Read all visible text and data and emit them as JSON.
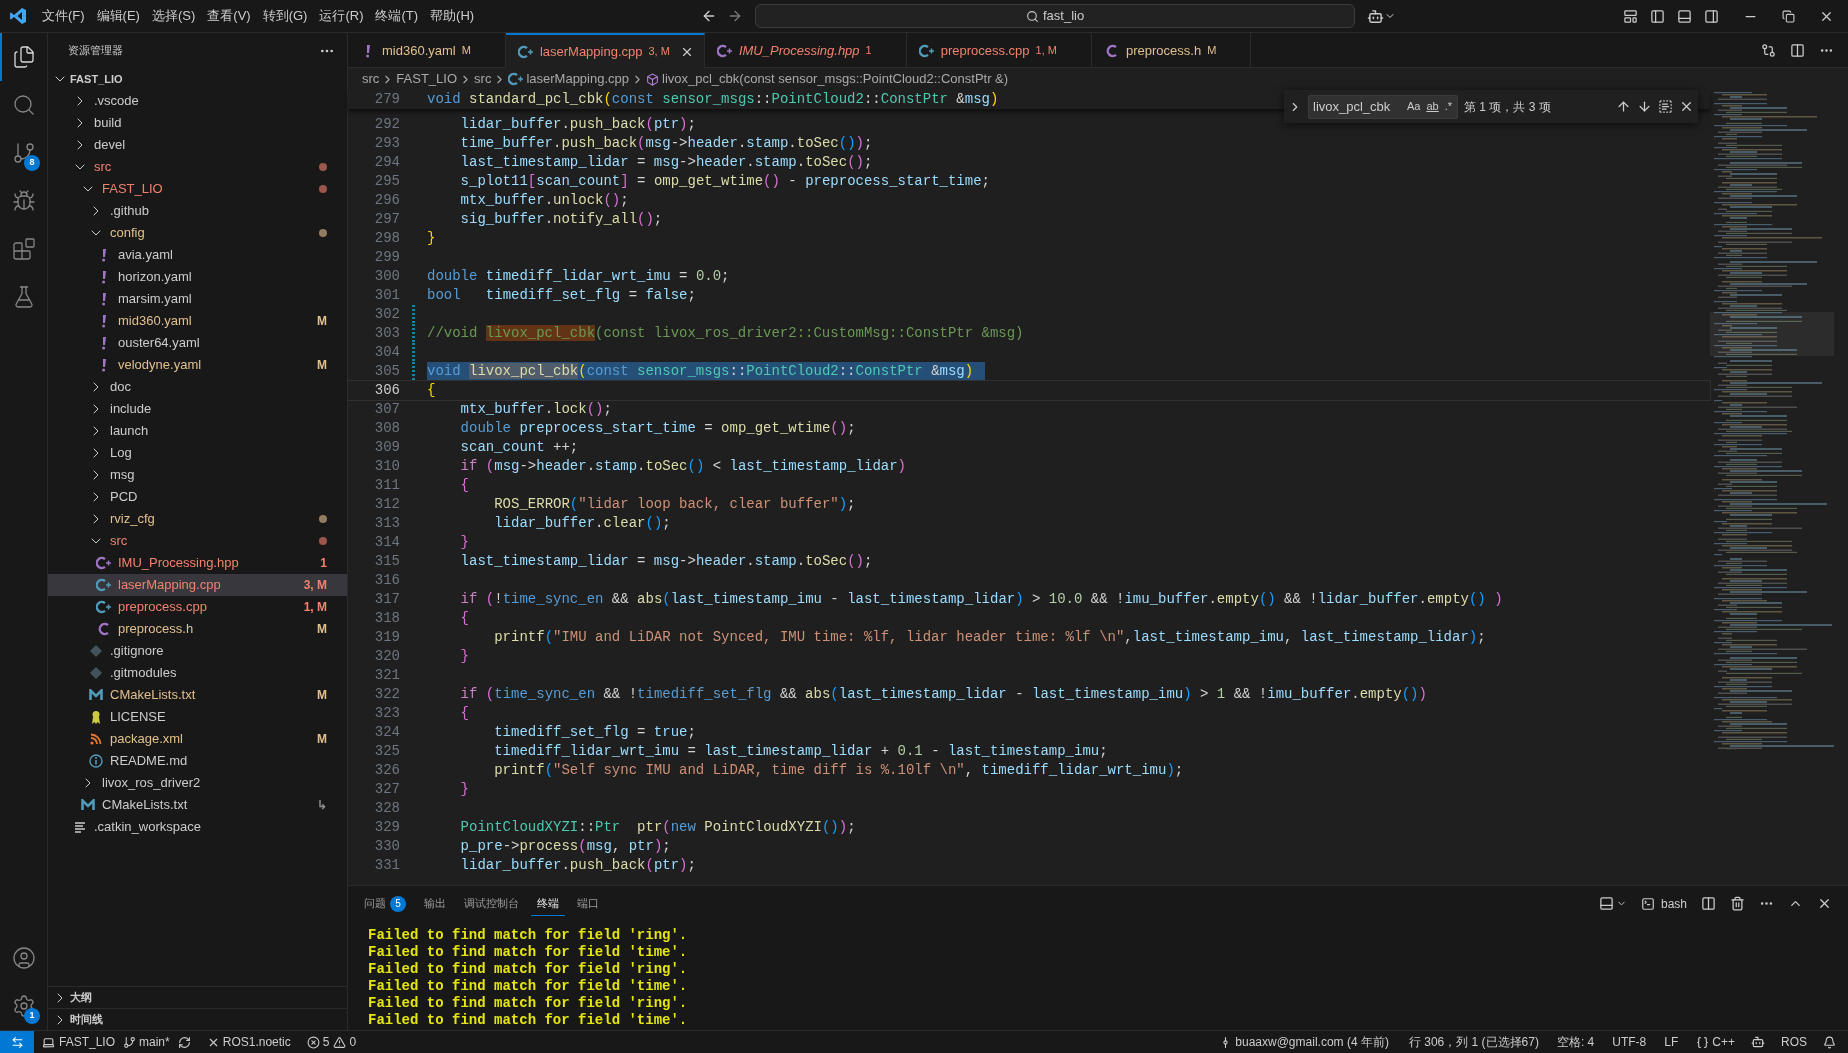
{
  "title_bar": {
    "menus": [
      "文件(F)",
      "编辑(E)",
      "选择(S)",
      "查看(V)",
      "转到(G)",
      "运行(R)",
      "终端(T)",
      "帮助(H)"
    ],
    "search": "fast_lio"
  },
  "activity_bar": {
    "items": [
      {
        "kind": "explorer",
        "selected": true
      },
      {
        "kind": "search",
        "selected": false
      },
      {
        "kind": "scm",
        "selected": false,
        "badge": "8"
      },
      {
        "kind": "debug",
        "selected": false
      },
      {
        "kind": "extensions",
        "selected": false
      },
      {
        "kind": "testing",
        "selected": false
      }
    ],
    "bottom": [
      {
        "kind": "account"
      },
      {
        "kind": "settings",
        "badge": "1"
      }
    ]
  },
  "explorer": {
    "title": "资源管理器",
    "root": {
      "label": "FAST_LIO",
      "expanded": true,
      "children": [
        {
          "label": ".vscode",
          "kind": "folder",
          "expanded": false,
          "selected": false
        },
        {
          "label": "build",
          "kind": "folder",
          "expanded": false,
          "selected": false
        },
        {
          "label": "devel",
          "kind": "folder",
          "expanded": false,
          "selected": false
        },
        {
          "label": "src",
          "kind": "folder",
          "expanded": true,
          "selected": false,
          "color": "#f2826f",
          "children": [
            {
              "label": "FAST_LIO",
              "kind": "folder",
              "expanded": true,
              "selected": false,
              "color": "#f2826f",
              "children": [
                {
                  "label": ".github",
                  "kind": "folder",
                  "expanded": false,
                  "selected": false
                },
                {
                  "label": "config",
                  "kind": "folder",
                  "expanded": true,
                  "selected": false,
                  "color": "#e2c08d",
                  "children": [
                    {
                      "label": "avia.yaml",
                      "kind": "yaml",
                      "selected": false
                    },
                    {
                      "label": "horizon.yaml",
                      "kind": "yaml",
                      "selected": false
                    },
                    {
                      "label": "marsim.yaml",
                      "kind": "yaml",
                      "selected": false
                    },
                    {
                      "label": "mid360.yaml",
                      "kind": "yaml",
                      "selected": false,
                      "color": "#e2c08d",
                      "badge": "M"
                    },
                    {
                      "label": "ouster64.yaml",
                      "kind": "yaml",
                      "selected": false
                    },
                    {
                      "label": "velodyne.yaml",
                      "kind": "yaml",
                      "selected": false,
                      "color": "#e2c08d",
                      "badge": "M"
                    }
                  ]
                },
                {
                  "label": "doc",
                  "kind": "folder",
                  "expanded": false,
                  "selected": false
                },
                {
                  "label": "include",
                  "kind": "folder",
                  "expanded": false,
                  "selected": false
                },
                {
                  "label": "launch",
                  "kind": "folder",
                  "expanded": false,
                  "selected": false
                },
                {
                  "label": "Log",
                  "kind": "folder",
                  "expanded": false,
                  "selected": false
                },
                {
                  "label": "msg",
                  "kind": "folder",
                  "expanded": false,
                  "selected": false
                },
                {
                  "label": "PCD",
                  "kind": "folder",
                  "expanded": false,
                  "selected": false
                },
                {
                  "label": "rviz_cfg",
                  "kind": "folder",
                  "expanded": false,
                  "selected": false,
                  "color": "#e2c08d"
                },
                {
                  "label": "src",
                  "kind": "folder",
                  "expanded": true,
                  "selected": false,
                  "color": "#f2826f",
                  "children": [
                    {
                      "label": "IMU_Processing.hpp",
                      "kind": "hpp",
                      "selected": false,
                      "color": "#f2826f",
                      "badge": "1"
                    },
                    {
                      "label": "laserMapping.cpp",
                      "kind": "cpp",
                      "selected": true,
                      "color": "#f2826f",
                      "badge": "3, M"
                    },
                    {
                      "label": "preprocess.cpp",
                      "kind": "cpp",
                      "selected": false,
                      "color": "#f2826f",
                      "badge": "1, M"
                    },
                    {
                      "label": "preprocess.h",
                      "kind": "h",
                      "selected": false,
                      "color": "#e2c08d",
                      "badge": "M"
                    }
                  ]
                },
                {
                  "label": ".gitignore",
                  "kind": "git",
                  "selected": false
                },
                {
                  "label": ".gitmodules",
                  "kind": "git",
                  "selected": false
                },
                {
                  "label": "CMakeLists.txt",
                  "kind": "cmake",
                  "selected": false,
                  "color": "#e2c08d",
                  "badge": "M"
                },
                {
                  "label": "LICENSE",
                  "kind": "license",
                  "selected": false
                },
                {
                  "label": "package.xml",
                  "kind": "xml",
                  "selected": false,
                  "color": "#e2c08d",
                  "badge": "M"
                },
                {
                  "label": "README.md",
                  "kind": "readme",
                  "selected": false
                }
              ]
            },
            {
              "label": "livox_ros_driver2",
              "kind": "folder",
              "expanded": false,
              "selected": false
            },
            {
              "label": "CMakeLists.txt",
              "kind": "cmake",
              "selected": false,
              "badge": "↳"
            }
          ]
        },
        {
          "label": ".catkin_workspace",
          "kind": "text",
          "selected": false
        }
      ]
    },
    "sections": [
      {
        "label": "大纲",
        "expanded": false
      },
      {
        "label": "时间线",
        "expanded": false
      }
    ]
  },
  "tabs": [
    {
      "label": "mid360.yaml",
      "kind": "yaml",
      "badge": "M",
      "color": "#e2c08d",
      "selected": false,
      "preview": false
    },
    {
      "label": "laserMapping.cpp",
      "kind": "cpp",
      "badge": "3, M",
      "color": "#f2826f",
      "selected": true,
      "preview": false
    },
    {
      "label": "IMU_Processing.hpp",
      "kind": "hpp",
      "badge": "1",
      "color": "#f2826f",
      "selected": false,
      "preview": true
    },
    {
      "label": "preprocess.cpp",
      "kind": "cpp",
      "badge": "1, M",
      "color": "#f2826f",
      "selected": false,
      "preview": false
    },
    {
      "label": "preprocess.h",
      "kind": "h",
      "badge": "M",
      "color": "#e2c08d",
      "selected": false,
      "preview": false
    }
  ],
  "breadcrumb": [
    {
      "kind": "folder",
      "label": "src"
    },
    {
      "kind": "folder",
      "label": "FAST_LIO"
    },
    {
      "kind": "folder",
      "label": "src"
    },
    {
      "kind": "cpp",
      "label": "laserMapping.cpp"
    },
    {
      "kind": "symbol",
      "label": "livox_pcl_cbk(const sensor_msgs::PointCloud2::ConstPtr &)"
    }
  ],
  "find": {
    "query": "livox_pcl_cbk",
    "options": [
      {
        "label": "Aa",
        "on": false
      },
      {
        "label": "ab",
        "on": false
      },
      {
        "label": ".*",
        "on": false
      }
    ],
    "result": "第 1 项，共 3 项"
  },
  "sticky": {
    "number": "279",
    "text": "void standard_pcl_cbk(const sensor_msgs::PointCloud2::ConstPtr &msg)"
  },
  "code": [
    {
      "number": "292",
      "text": "    lidar_buffer.push_back(ptr);"
    },
    {
      "number": "293",
      "text": "    time_buffer.push_back(msg->header.stamp.toSec());"
    },
    {
      "number": "294",
      "text": "    last_timestamp_lidar = msg->header.stamp.toSec();"
    },
    {
      "number": "295",
      "text": "    s_plot11[scan_count] = omp_get_wtime() - preprocess_start_time;"
    },
    {
      "number": "296",
      "text": "    mtx_buffer.unlock();"
    },
    {
      "number": "297",
      "text": "    sig_buffer.notify_all();"
    },
    {
      "number": "298",
      "text": "}"
    },
    {
      "number": "299"
    },
    {
      "number": "300",
      "text": "double timediff_lidar_wrt_imu = 0.0;"
    },
    {
      "number": "301",
      "text": "bool   timediff_set_flg = false;"
    },
    {
      "number": "302",
      "modified": true
    },
    {
      "number": "303",
      "modified": true,
      "text": "//void livox_pcl_cbk(const livox_ros_driver2::CustomMsg::ConstPtr &msg)"
    },
    {
      "number": "304",
      "modified": true
    },
    {
      "number": "305",
      "modified": true,
      "selected": true,
      "text": "void livox_pcl_cbk(const sensor_msgs::PointCloud2::ConstPtr &msg)"
    },
    {
      "number": "306",
      "current": true,
      "text": "{"
    },
    {
      "number": "307",
      "text": "    mtx_buffer.lock();"
    },
    {
      "number": "308",
      "text": "    double preprocess_start_time = omp_get_wtime();"
    },
    {
      "number": "309",
      "text": "    scan_count ++;"
    },
    {
      "number": "310",
      "text": "    if (msg->header.stamp.toSec() < last_timestamp_lidar)"
    },
    {
      "number": "311",
      "text": "    {"
    },
    {
      "number": "312",
      "text": "        ROS_ERROR(\"lidar loop back, clear buffer\");"
    },
    {
      "number": "313",
      "text": "        lidar_buffer.clear();"
    },
    {
      "number": "314",
      "text": "    }"
    },
    {
      "number": "315",
      "text": "    last_timestamp_lidar = msg->header.stamp.toSec();"
    },
    {
      "number": "316"
    },
    {
      "number": "317",
      "text": "    if (!time_sync_en && abs(last_timestamp_imu - last_timestamp_lidar) > 10.0 && !imu_buffer.empty() && !lidar_buffer.empty() )"
    },
    {
      "number": "318",
      "text": "    {"
    },
    {
      "number": "319",
      "text": "        printf(\"IMU and LiDAR not Synced, IMU time: %lf, lidar header time: %lf \\n\",last_timestamp_imu, last_timestamp_lidar);"
    },
    {
      "number": "320",
      "text": "    }"
    },
    {
      "number": "321"
    },
    {
      "number": "322",
      "text": "    if (time_sync_en && !timediff_set_flg && abs(last_timestamp_lidar - last_timestamp_imu) > 1 && !imu_buffer.empty())"
    },
    {
      "number": "323",
      "text": "    {"
    },
    {
      "number": "324",
      "text": "        timediff_set_flg = true;"
    },
    {
      "number": "325",
      "text": "        timediff_lidar_wrt_imu = last_timestamp_lidar + 0.1 - last_timestamp_imu;"
    },
    {
      "number": "326",
      "text": "        printf(\"Self sync IMU and LiDAR, time diff is %.10lf \\n\", timediff_lidar_wrt_imu);"
    },
    {
      "number": "327",
      "text": "    }"
    },
    {
      "number": "328"
    },
    {
      "number": "329",
      "text": "    PointCloudXYZI::Ptr  ptr(new PointCloudXYZI());"
    },
    {
      "number": "330",
      "text": "    p_pre->process(msg, ptr);"
    },
    {
      "number": "331",
      "text": "    lidar_buffer.push_back(ptr);"
    }
  ],
  "panel": {
    "tabs": [
      {
        "label": "问题",
        "badge": "5",
        "selected": false
      },
      {
        "label": "输出",
        "selected": false
      },
      {
        "label": "调试控制台",
        "selected": false
      },
      {
        "label": "终端",
        "selected": true
      },
      {
        "label": "端口",
        "selected": false
      }
    ],
    "shell": "bash",
    "terminal": [
      "Failed to find match for field 'ring'.",
      "Failed to find match for field 'time'.",
      "Failed to find match for field 'ring'.",
      "Failed to find match for field 'time'.",
      "Failed to find match for field 'ring'.",
      "Failed to find match for field 'time'."
    ]
  },
  "status_bar": {
    "workspace": "FAST_LIO",
    "branch": "main*",
    "ros_env": "ROS1.noetic",
    "errors": "5",
    "warnings": "0",
    "blame": "buaaxw@gmail.com (4 年前)",
    "position": "行 306，列 1 (已选择67)",
    "indent": "空格: 4",
    "encoding": "UTF-8",
    "eol": "LF",
    "language": "C++",
    "ros": "ROS"
  }
}
